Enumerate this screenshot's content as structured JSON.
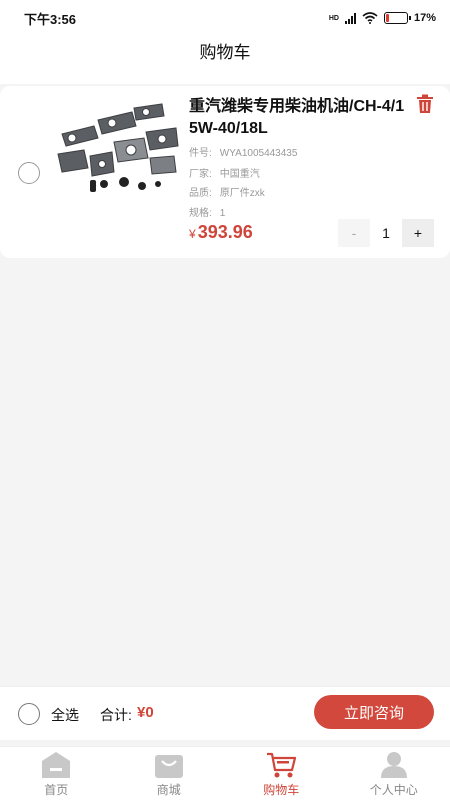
{
  "status_bar": {
    "time": "下午3:56",
    "battery": "17%",
    "battery_level": 0.17,
    "network": "HD"
  },
  "header": {
    "title": "购物车"
  },
  "cart_item": {
    "title": "重汽潍柴专用柴油机油/CH-4/15W-40/18L",
    "attributes": [
      {
        "key": "件号:",
        "value": "WYA1005443435"
      },
      {
        "key": "厂家:",
        "value": "中国重汽"
      },
      {
        "key": "品质:",
        "value": "原厂件zxk"
      },
      {
        "key": "规格:",
        "value": "1"
      }
    ],
    "currency": "¥",
    "price": "393.96",
    "quantity": "1",
    "minus_label": "-",
    "plus_label": "+"
  },
  "bottom_bar": {
    "select_all": "全选",
    "total_label": "合计:",
    "total_value": "¥0",
    "consult_button": "立即咨询"
  },
  "tabs": [
    {
      "label": "首页",
      "icon": "home-icon"
    },
    {
      "label": "商城",
      "icon": "shopping-bag-icon"
    },
    {
      "label": "购物车",
      "icon": "cart-icon",
      "active": true
    },
    {
      "label": "个人中心",
      "icon": "person-icon"
    }
  ],
  "colors": {
    "accent": "#d0453a",
    "button": "#d2483c",
    "inactive_icon": "#c8c8c8",
    "background": "#f4f4f4"
  }
}
